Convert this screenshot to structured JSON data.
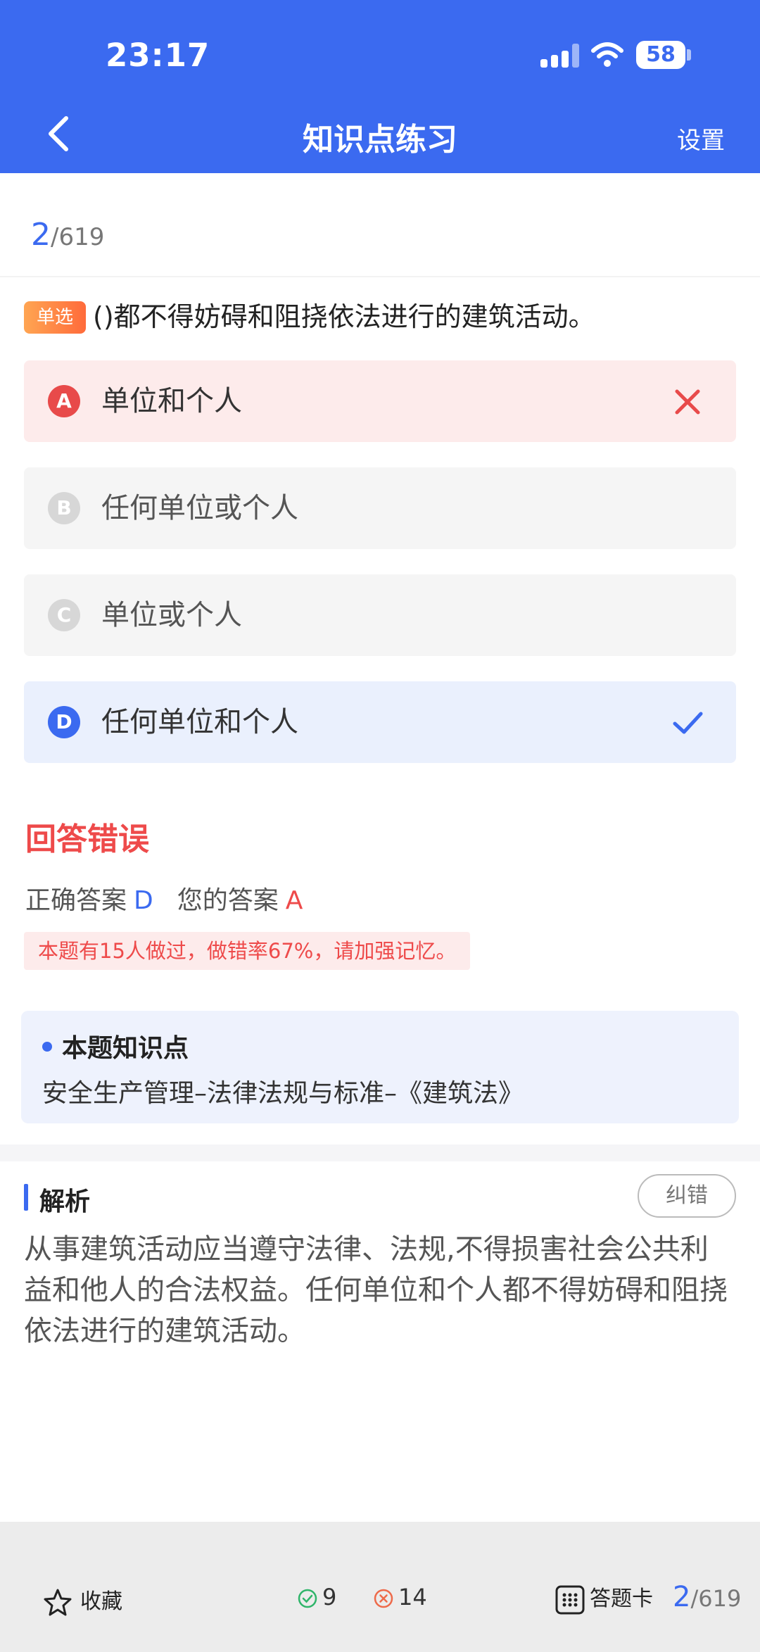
{
  "status": {
    "time": "23:17",
    "battery": "58"
  },
  "nav": {
    "title": "知识点练习",
    "settings": "设置"
  },
  "progress": {
    "current": "2",
    "total": "/619"
  },
  "question": {
    "type": "单选",
    "text": "()都不得妨碍和阻挠依法进行的建筑活动。",
    "options": [
      {
        "letter": "A",
        "text": "单位和个人",
        "state": "wrong"
      },
      {
        "letter": "B",
        "text": "任何单位或个人",
        "state": "neutral"
      },
      {
        "letter": "C",
        "text": "单位或个人",
        "state": "neutral"
      },
      {
        "letter": "D",
        "text": "任何单位和个人",
        "state": "correct"
      }
    ]
  },
  "result": {
    "title": "回答错误",
    "correct_label": "正确答案",
    "correct_value": "D",
    "your_label": "您的答案",
    "your_value": "A",
    "stat_tip": "本题有15人做过，做错率67%，请加强记忆。"
  },
  "knowledge": {
    "title": "本题知识点",
    "text": "安全生产管理–法律法规与标准–《建筑法》"
  },
  "analysis": {
    "title": "解析",
    "correct_button": "纠错",
    "text": "从事建筑活动应当遵守法律、法规,不得损害社会公共利益和他人的合法权益。任何单位和个人都不得妨碍和阻挠依法进行的建筑活动。"
  },
  "bottom": {
    "favorite": "收藏",
    "right_count": "9",
    "wrong_count": "14",
    "card": "答题卡",
    "progress_current": "2",
    "progress_total": "/619"
  },
  "colors": {
    "primary": "#3b6af0",
    "wrong": "#ee4a4a",
    "right": "#2fb56a"
  },
  "icons": {
    "back": "back-arrow-icon",
    "wrong_mark": "cross-icon",
    "right_mark": "check-icon",
    "favorite": "star-icon",
    "card": "grid-icon"
  }
}
